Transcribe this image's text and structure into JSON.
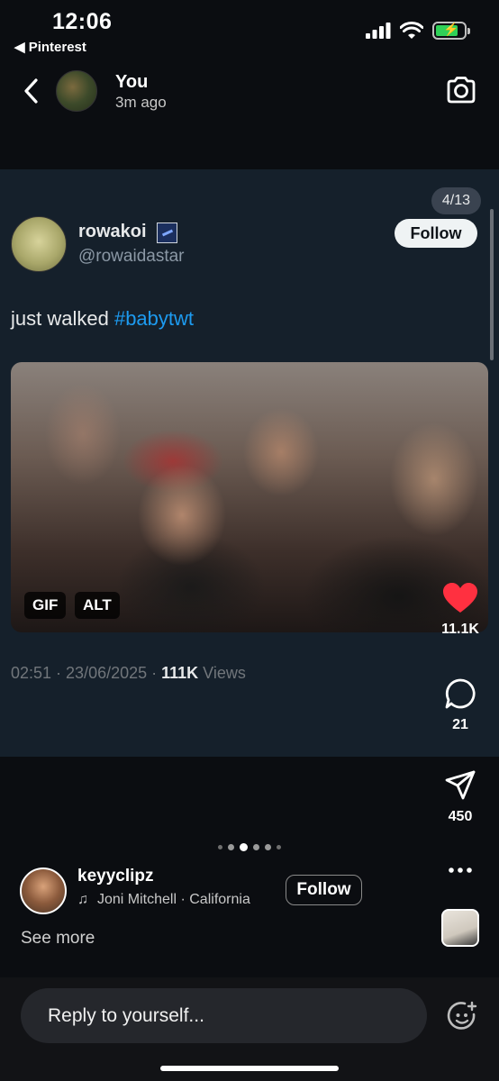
{
  "status_bar": {
    "time": "12:06",
    "back_app": "◀ Pinterest"
  },
  "story_header": {
    "user": "You",
    "time_ago": "3m ago",
    "icons": {
      "back": "chevron-left-icon",
      "camera": "camera-icon"
    }
  },
  "tweet": {
    "page_counter": "4/13",
    "author_name": "rowakoi",
    "author_handle": "@rowaidastar",
    "follow_label": "Follow",
    "text_plain": "just walked ",
    "hashtag": "#babytwt",
    "media_badges": [
      "GIF",
      "ALT"
    ],
    "timestamp": "02:51 · 23/06/2025 · ",
    "views_count": "111K",
    "views_label": " Views",
    "colors": {
      "card_bg": "#15202b",
      "hashtag": "#1d9bf0"
    }
  },
  "actions": {
    "like_count": "11.1K",
    "comment_count": "21",
    "share_count": "450",
    "icons": [
      "heart-icon",
      "comment-icon",
      "send-icon",
      "more-icon"
    ],
    "colors": {
      "like": "#ff3040"
    }
  },
  "pagination": {
    "total": 6,
    "active_index": 2
  },
  "music": {
    "username": "keyyclipz",
    "note_icon": "♫",
    "track": "Joni Mitchell · California",
    "follow_label": "Follow",
    "see_more": "See more"
  },
  "reply": {
    "placeholder": "Reply to yourself...",
    "sticker_icon": "sticker-icon"
  }
}
